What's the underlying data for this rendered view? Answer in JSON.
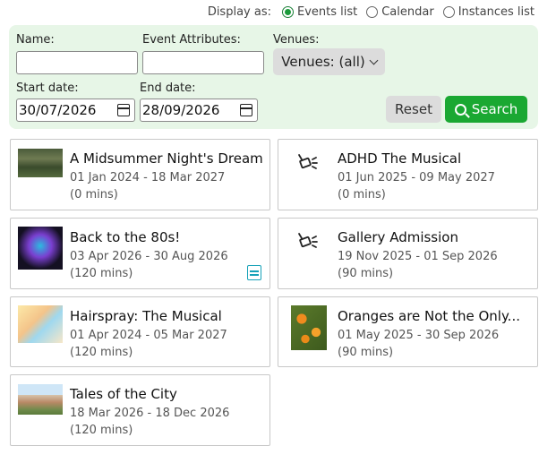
{
  "display": {
    "label": "Display as:",
    "options": [
      {
        "label": "Events list",
        "selected": true
      },
      {
        "label": "Calendar",
        "selected": false
      },
      {
        "label": "Instances list",
        "selected": false
      }
    ]
  },
  "filters": {
    "name_label": "Name:",
    "name_value": "",
    "attributes_label": "Event Attributes:",
    "attributes_value": "",
    "venues_label": "Venues:",
    "venues_value": "Venues: (all)",
    "start_label": "Start date:",
    "start_value": "30/07/2026",
    "end_label": "End date:",
    "end_value": "28/09/2026",
    "reset_label": "Reset",
    "search_label": "Search"
  },
  "events": [
    {
      "title": "A Midsummer Night's Dream",
      "dates": "01 Jan 2024 - 18 Mar 2027",
      "duration": "(0 mins)",
      "thumb": "forest-image"
    },
    {
      "title": "ADHD The Musical",
      "dates": "01 Jun 2025 - 09 May 2027",
      "duration": "(0 mins)",
      "thumb": "gadget-icon"
    },
    {
      "title": "Back to the 80s!",
      "dates": "03 Apr 2026 - 30 Aug 2026",
      "duration": "(120 mins)",
      "thumb": "80s-image",
      "has_doc": true
    },
    {
      "title": "Gallery Admission",
      "dates": "19 Nov 2025 - 01 Sep 2026",
      "duration": "(90 mins)",
      "thumb": "gadget-icon"
    },
    {
      "title": "Hairspray: The Musical",
      "dates": "01 Apr 2024 - 05 Mar 2027",
      "duration": "(120 mins)",
      "thumb": "hairspray-image"
    },
    {
      "title": "Oranges are Not the Only...",
      "dates": "01 May 2025 - 30 Sep 2026",
      "duration": "(90 mins)",
      "thumb": "oranges-image"
    },
    {
      "title": "Tales of the City",
      "dates": "18 Mar 2026 - 18 Dec 2026",
      "duration": "(120 mins)",
      "thumb": "city-image"
    }
  ],
  "colors": {
    "panel_bg": "#e7f6e7",
    "search_green": "#1aa832",
    "doc_teal": "#17a2b8"
  }
}
